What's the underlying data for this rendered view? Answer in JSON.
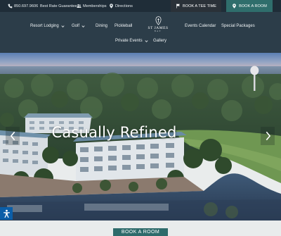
{
  "topbar": {
    "phone": "850.697.9606",
    "guarantee": "Best Rate Guarantee",
    "memberships": "Memberships",
    "directions": "Directions",
    "tee_time": "BOOK A TEE TIME",
    "book_room": "BOOK A ROOM"
  },
  "nav": {
    "resort_lodging": "Resort Lodging",
    "golf": "Golf",
    "dining": "Dining",
    "pickleball": "Pickleball",
    "events_calendar": "Events Calendar",
    "special_packages": "Special Packages",
    "private_events": "Private Events",
    "gallery": "Gallery"
  },
  "logo": {
    "name": "ST JAMES",
    "sub": "BAY"
  },
  "hero": {
    "title": "Casually Refined"
  },
  "cta": {
    "book_room": "BOOK A ROOM"
  },
  "colors": {
    "topbar": "#1f2d38",
    "nav": "#2c3d49",
    "accent": "#2f6e6c",
    "accessibility": "#0b5ea8"
  },
  "icons": [
    "phone-icon",
    "check-icon",
    "users-icon",
    "map-pin-icon",
    "flag-icon",
    "chevron-down-icon",
    "chevron-left-icon",
    "chevron-right-icon",
    "accessibility-icon"
  ]
}
